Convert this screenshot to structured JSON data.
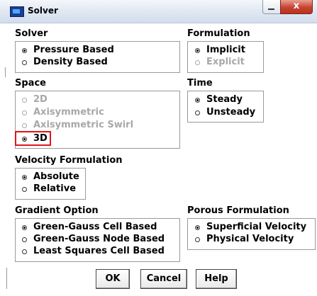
{
  "window": {
    "title": "Solver",
    "close_glyph": "x"
  },
  "solver": {
    "title": "Solver",
    "options": [
      {
        "label": "Pressure Based",
        "selected": true,
        "enabled": true
      },
      {
        "label": "Density Based",
        "selected": false,
        "enabled": true
      }
    ]
  },
  "formulation": {
    "title": "Formulation",
    "options": [
      {
        "label": "Implicit",
        "selected": true,
        "enabled": true
      },
      {
        "label": "Explicit",
        "selected": false,
        "enabled": false
      }
    ]
  },
  "space": {
    "title": "Space",
    "options": [
      {
        "label": "2D",
        "selected": false,
        "enabled": false
      },
      {
        "label": "Axisymmetric",
        "selected": false,
        "enabled": false
      },
      {
        "label": "Axisymmetric Swirl",
        "selected": false,
        "enabled": false
      },
      {
        "label": "3D",
        "selected": true,
        "enabled": true
      }
    ],
    "highlight_color": "#e0151b"
  },
  "time": {
    "title": "Time",
    "options": [
      {
        "label": "Steady",
        "selected": true,
        "enabled": true
      },
      {
        "label": "Unsteady",
        "selected": false,
        "enabled": true
      }
    ]
  },
  "velocity_formulation": {
    "title": "Velocity Formulation",
    "options": [
      {
        "label": "Absolute",
        "selected": true,
        "enabled": true
      },
      {
        "label": "Relative",
        "selected": false,
        "enabled": true
      }
    ]
  },
  "gradient_option": {
    "title": "Gradient Option",
    "options": [
      {
        "label": "Green-Gauss Cell Based",
        "selected": true,
        "enabled": true
      },
      {
        "label": "Green-Gauss Node Based",
        "selected": false,
        "enabled": true
      },
      {
        "label": "Least Squares Cell Based",
        "selected": false,
        "enabled": true
      }
    ]
  },
  "porous_formulation": {
    "title": "Porous Formulation",
    "options": [
      {
        "label": "Superficial Velocity",
        "selected": true,
        "enabled": true
      },
      {
        "label": "Physical Velocity",
        "selected": false,
        "enabled": true
      }
    ]
  },
  "buttons": {
    "ok": "OK",
    "cancel": "Cancel",
    "help": "Help"
  }
}
